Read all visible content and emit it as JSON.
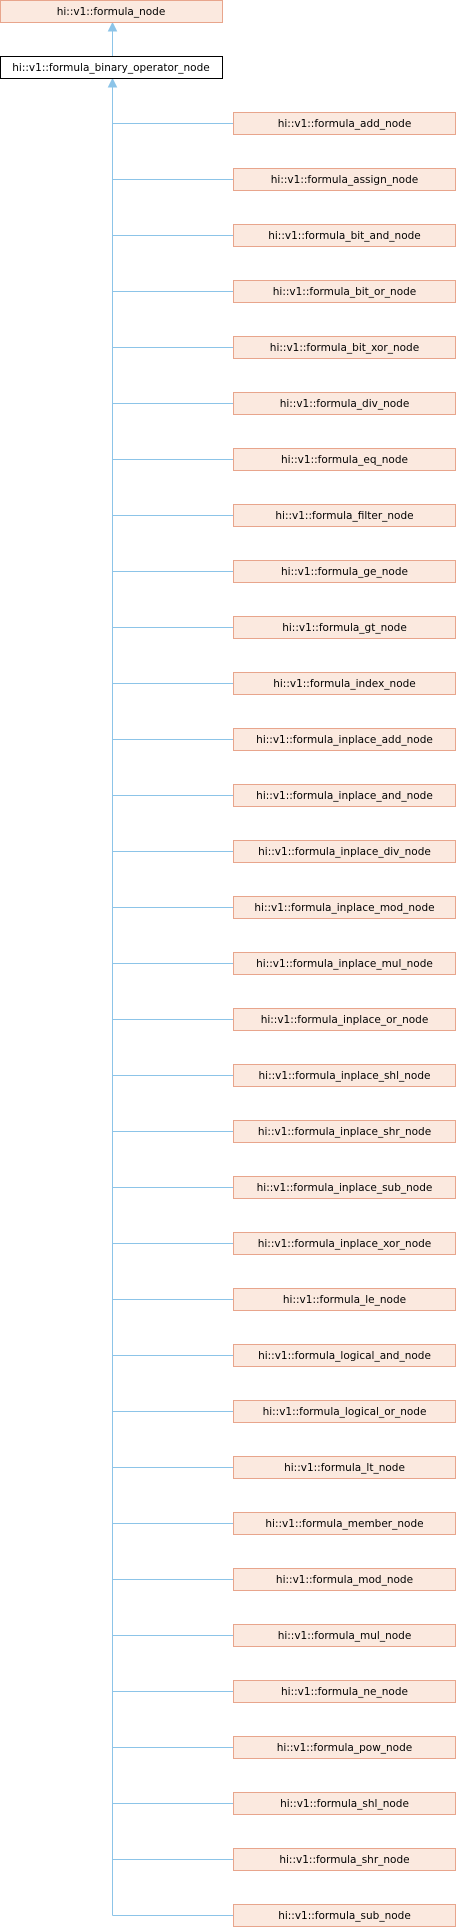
{
  "diagram": {
    "base": "hi::v1::formula_node",
    "current": "hi::v1::formula_binary_operator_node",
    "derived": [
      "hi::v1::formula_add_node",
      "hi::v1::formula_assign_node",
      "hi::v1::formula_bit_and_node",
      "hi::v1::formula_bit_or_node",
      "hi::v1::formula_bit_xor_node",
      "hi::v1::formula_div_node",
      "hi::v1::formula_eq_node",
      "hi::v1::formula_filter_node",
      "hi::v1::formula_ge_node",
      "hi::v1::formula_gt_node",
      "hi::v1::formula_index_node",
      "hi::v1::formula_inplace_add_node",
      "hi::v1::formula_inplace_and_node",
      "hi::v1::formula_inplace_div_node",
      "hi::v1::formula_inplace_mod_node",
      "hi::v1::formula_inplace_mul_node",
      "hi::v1::formula_inplace_or_node",
      "hi::v1::formula_inplace_shl_node",
      "hi::v1::formula_inplace_shr_node",
      "hi::v1::formula_inplace_sub_node",
      "hi::v1::formula_inplace_xor_node",
      "hi::v1::formula_le_node",
      "hi::v1::formula_logical_and_node",
      "hi::v1::formula_logical_or_node",
      "hi::v1::formula_lt_node",
      "hi::v1::formula_member_node",
      "hi::v1::formula_mod_node",
      "hi::v1::formula_mul_node",
      "hi::v1::formula_ne_node",
      "hi::v1::formula_pow_node",
      "hi::v1::formula_shl_node",
      "hi::v1::formula_shr_node",
      "hi::v1::formula_sub_node"
    ],
    "colors": {
      "node_fill": "#fbe9df",
      "node_border": "#e8a58c",
      "current_border": "#000000",
      "edge": "#8cc4e8"
    }
  }
}
